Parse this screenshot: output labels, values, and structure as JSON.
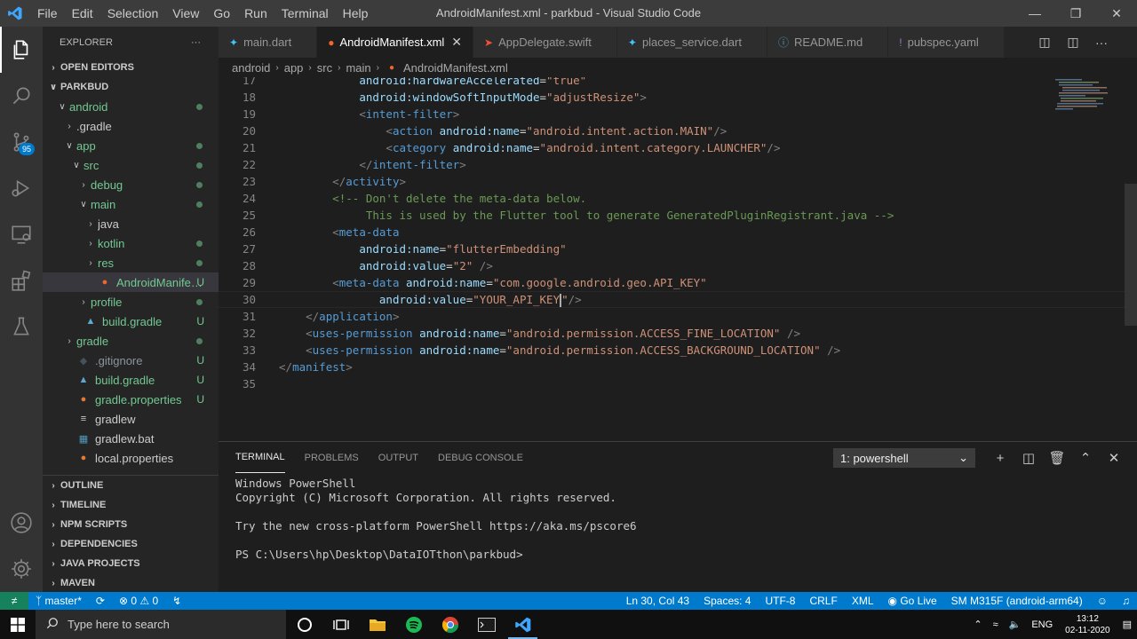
{
  "window": {
    "title": "AndroidManifest.xml - parkbud - Visual Studio Code",
    "menu": [
      "File",
      "Edit",
      "Selection",
      "View",
      "Go",
      "Run",
      "Terminal",
      "Help"
    ]
  },
  "activity": {
    "scm_badge": "95"
  },
  "explorer": {
    "header": "EXPLORER",
    "more": "···",
    "open_editors": "OPEN EDITORS",
    "project": "PARKBUD",
    "tree": [
      {
        "label": "android",
        "chev": "∨",
        "indent": 1,
        "status": "dot"
      },
      {
        "label": ".gradle",
        "chev": "›",
        "indent": 2,
        "status": ""
      },
      {
        "label": "app",
        "chev": "∨",
        "indent": 2,
        "status": "dot"
      },
      {
        "label": "src",
        "chev": "∨",
        "indent": 3,
        "status": "dot"
      },
      {
        "label": "debug",
        "chev": "›",
        "indent": 4,
        "status": "dot"
      },
      {
        "label": "main",
        "chev": "∨",
        "indent": 4,
        "status": "dot"
      },
      {
        "label": "java",
        "chev": "›",
        "indent": 5,
        "status": ""
      },
      {
        "label": "kotlin",
        "chev": "›",
        "indent": 5,
        "status": "dot"
      },
      {
        "label": "res",
        "chev": "›",
        "indent": 5,
        "status": "dot"
      },
      {
        "label": "AndroidManifes...",
        "chev": "",
        "indent": 5,
        "status": "U",
        "icon": "android"
      },
      {
        "label": "profile",
        "chev": "›",
        "indent": 4,
        "status": "dot"
      },
      {
        "label": "build.gradle",
        "chev": "",
        "indent": 3,
        "status": "U",
        "icon": "gradle"
      },
      {
        "label": "gradle",
        "chev": "›",
        "indent": 2,
        "status": "dot"
      },
      {
        "label": ".gitignore",
        "chev": "",
        "indent": 2,
        "status": "U",
        "icon": "git"
      },
      {
        "label": "build.gradle",
        "chev": "",
        "indent": 2,
        "status": "U",
        "icon": "gradle"
      },
      {
        "label": "gradle.properties",
        "chev": "",
        "indent": 2,
        "status": "U",
        "icon": "props"
      },
      {
        "label": "gradlew",
        "chev": "",
        "indent": 2,
        "status": "",
        "icon": "lines"
      },
      {
        "label": "gradlew.bat",
        "chev": "",
        "indent": 2,
        "status": "",
        "icon": "win"
      },
      {
        "label": "local.properties",
        "chev": "",
        "indent": 2,
        "status": "",
        "icon": "props"
      }
    ],
    "sections": [
      "OUTLINE",
      "TIMELINE",
      "NPM SCRIPTS",
      "DEPENDENCIES",
      "JAVA PROJECTS",
      "MAVEN"
    ]
  },
  "tabs": [
    {
      "label": "main.dart",
      "icon": "dart",
      "active": false
    },
    {
      "label": "AndroidManifest.xml",
      "icon": "android",
      "active": true
    },
    {
      "label": "AppDelegate.swift",
      "icon": "swift",
      "active": false
    },
    {
      "label": "places_service.dart",
      "icon": "dart",
      "active": false
    },
    {
      "label": "README.md",
      "icon": "info",
      "active": false
    },
    {
      "label": "pubspec.yaml",
      "icon": "yaml",
      "active": false
    }
  ],
  "breadcrumb": [
    "android",
    "app",
    "src",
    "main",
    "AndroidManifest.xml"
  ],
  "editor": {
    "lines": [
      {
        "n": "17",
        "html": "            <span class='attr'>android:hardwareAccelerated</span>=<span class='str'>\"true\"</span>"
      },
      {
        "n": "18",
        "html": "            <span class='attr'>android:windowSoftInputMode</span>=<span class='str'>\"adjustResize\"</span><span class='punc'>&gt;</span>"
      },
      {
        "n": "19",
        "html": "            <span class='punc'>&lt;</span><span class='tag'>intent-filter</span><span class='punc'>&gt;</span>"
      },
      {
        "n": "20",
        "html": "                <span class='punc'>&lt;</span><span class='tag'>action</span> <span class='attr'>android:name</span>=<span class='str'>\"android.intent.action.MAIN\"</span><span class='punc'>/&gt;</span>"
      },
      {
        "n": "21",
        "html": "                <span class='punc'>&lt;</span><span class='tag'>category</span> <span class='attr'>android:name</span>=<span class='str'>\"android.intent.category.LAUNCHER\"</span><span class='punc'>/&gt;</span>"
      },
      {
        "n": "22",
        "html": "            <span class='punc'>&lt;/</span><span class='tag'>intent-filter</span><span class='punc'>&gt;</span>"
      },
      {
        "n": "23",
        "html": "        <span class='punc'>&lt;/</span><span class='tag'>activity</span><span class='punc'>&gt;</span>"
      },
      {
        "n": "24",
        "html": "        <span class='com'>&lt;!-- Don't delete the meta-data below.</span>"
      },
      {
        "n": "25",
        "html": "<span class='com'>             This is used by the Flutter tool to generate GeneratedPluginRegistrant.java --&gt;</span>"
      },
      {
        "n": "26",
        "html": "        <span class='punc'>&lt;</span><span class='tag'>meta-data</span>"
      },
      {
        "n": "27",
        "html": "            <span class='attr'>android:name</span>=<span class='str'>\"flutterEmbedding\"</span>"
      },
      {
        "n": "28",
        "html": "            <span class='attr'>android:value</span>=<span class='str'>\"2\"</span> <span class='punc'>/&gt;</span>"
      },
      {
        "n": "29",
        "html": "        <span class='punc'>&lt;</span><span class='tag'>meta-data</span> <span class='attr'>android:name</span>=<span class='str'>\"com.google.android.geo.API_KEY\"</span>"
      },
      {
        "n": "30",
        "html": "               <span class='attr'>android:value</span>=<span class='str'>\"YOUR_API_KEY\"</span><span class='punc'>/&gt;</span>"
      },
      {
        "n": "31",
        "html": "    <span class='punc'>&lt;/</span><span class='tag'>application</span><span class='punc'>&gt;</span>"
      },
      {
        "n": "32",
        "html": "    <span class='punc'>&lt;</span><span class='tag'>uses-permission</span> <span class='attr'>android:name</span>=<span class='str'>\"android.permission.ACCESS_FINE_LOCATION\"</span> <span class='punc'>/&gt;</span>"
      },
      {
        "n": "33",
        "html": "    <span class='punc'>&lt;</span><span class='tag'>uses-permission</span> <span class='attr'>android:name</span>=<span class='str'>\"android.permission.ACCESS_BACKGROUND_LOCATION\"</span> <span class='punc'>/&gt;</span>"
      },
      {
        "n": "34",
        "html": "<span class='punc'>&lt;/</span><span class='tag'>manifest</span><span class='punc'>&gt;</span>"
      },
      {
        "n": "35",
        "html": ""
      }
    ],
    "cursor_line": "30"
  },
  "panel": {
    "tabs": [
      "TERMINAL",
      "PROBLEMS",
      "OUTPUT",
      "DEBUG CONSOLE"
    ],
    "active_tab": "TERMINAL",
    "terminal_select": "1: powershell",
    "terminal_lines": [
      "Windows PowerShell",
      "Copyright (C) Microsoft Corporation. All rights reserved.",
      "",
      "Try the new cross-platform PowerShell https://aka.ms/pscore6",
      "",
      "PS C:\\Users\\hp\\Desktop\\DataIOTthon\\parkbud>"
    ]
  },
  "status": {
    "branch": "master*",
    "errors": "0",
    "warnings": "0",
    "position": "Ln 30, Col 43",
    "spaces": "Spaces: 4",
    "encoding": "UTF-8",
    "eol": "CRLF",
    "language": "XML",
    "golive": "Go Live",
    "device": "SM M315F (android-arm64)"
  },
  "taskbar": {
    "search_placeholder": "Type here to search",
    "lang": "ENG",
    "time": "13:12",
    "date": "02-11-2020"
  },
  "colors": {
    "accent": "#007acc",
    "activity_bg": "#333333",
    "sidebar_bg": "#252526",
    "editor_bg": "#1e1e1e"
  }
}
